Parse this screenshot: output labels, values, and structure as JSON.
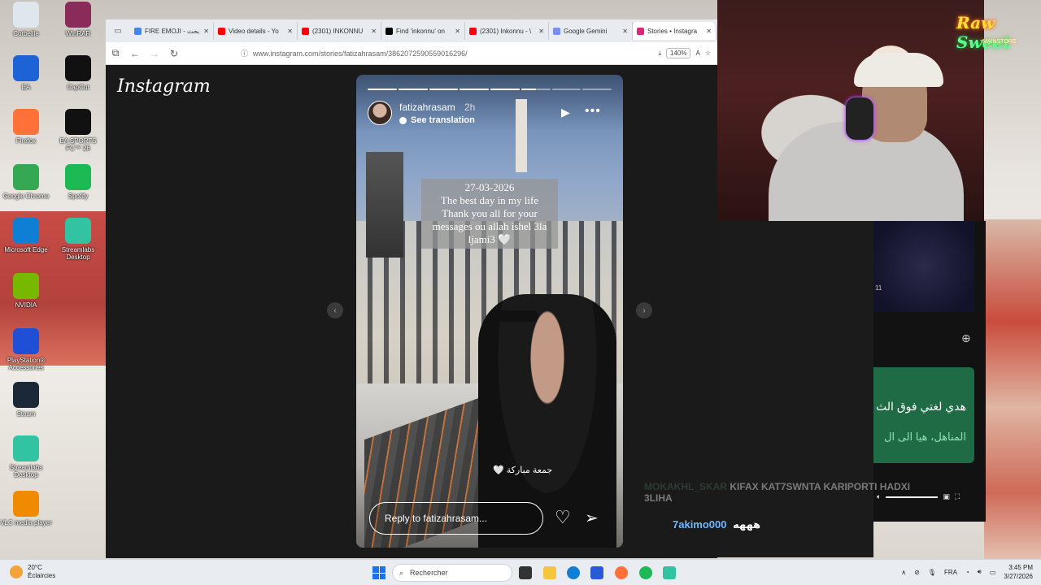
{
  "desktop": {
    "icons": [
      {
        "label": "Corbeille",
        "icon": "recycle-bin-icon",
        "color": "#dfe6ee"
      },
      {
        "label": "WinRAR",
        "icon": "winrar-icon",
        "color": "#8a2b5a"
      },
      {
        "label": "EA",
        "icon": "ea-icon",
        "color": "#1e63d6"
      },
      {
        "label": "CapCut",
        "icon": "capcut-icon",
        "color": "#111111"
      },
      {
        "label": "Firefox",
        "icon": "firefox-icon",
        "color": "#ff7139"
      },
      {
        "label": "EA SPORTS FC™ 26",
        "icon": "ea-fc-icon",
        "color": "#111111"
      },
      {
        "label": "Google Chrome",
        "icon": "chrome-icon",
        "color": "#34a853"
      },
      {
        "label": "Spotify",
        "icon": "spotify-icon",
        "color": "#1db954"
      },
      {
        "label": "Microsoft Edge",
        "icon": "edge-icon",
        "color": "#0f7fd6"
      },
      {
        "label": "Streamlabs Desktop",
        "icon": "streamlabs-icon",
        "color": "#31c3a2"
      },
      {
        "label": "NVIDIA",
        "icon": "nvidia-icon",
        "color": "#76b900"
      },
      {
        "label": "PlayStation® Accessories",
        "icon": "playstation-icon",
        "color": "#1e4fd6"
      },
      {
        "label": "Steam",
        "icon": "steam-icon",
        "color": "#1b2838"
      },
      {
        "label": "Streamlabs Desktop",
        "icon": "streamlabs-icon",
        "color": "#31c3a2"
      },
      {
        "label": "VLC media player",
        "icon": "vlc-icon",
        "color": "#f08a00"
      }
    ]
  },
  "browser": {
    "tabs": [
      {
        "label": "FIRE EMOJI - بحث",
        "fav_color": "#4285f4"
      },
      {
        "label": "Video details - Yo",
        "fav_color": "#ff0000"
      },
      {
        "label": "(2301) INKONNU",
        "fav_color": "#ff0000"
      },
      {
        "label": "Find 'inkonnu' on",
        "fav_color": "#000000"
      },
      {
        "label": "(2301) Inkonnu - \\",
        "fav_color": "#ff0000"
      },
      {
        "label": "Google Gemini",
        "fav_color": "#7b8cf5"
      },
      {
        "label": "Stories • Instagra",
        "fav_color": "#d62976"
      }
    ],
    "url": "www.instagram.com/stories/fatizahrasam/3862072590559016296/",
    "zoom": "140%"
  },
  "instagram": {
    "logo": "Instagram",
    "story": {
      "username": "fatizahrasam",
      "time": "2h",
      "see_translation": "See translation",
      "caption": "27-03-2026\nThe best day in my life\nThank you all for your messages ou allah ishel 3la ljami3 🤍",
      "sticker": "🤍 جمعة مباركة",
      "reply_placeholder": "Reply to fatizahrasam...",
      "progress_segments": 8,
      "progress_done": 5,
      "progress_current_fraction": 0.5
    }
  },
  "stream_overlay": {
    "neon_main": "Raw",
    "neon_accent": "Sweet",
    "neon_sub": "MAINSTORE",
    "media_badge": "11",
    "green_card_line1": "هدي لغتي فوق الث",
    "green_card_line2": "المناهل، هيا الى ال",
    "chat": [
      {
        "user": "MOKAKHL_SKAR",
        "message": "KIFAX KAT7SWNTA KARIPORTI HADXI 3LIHA"
      },
      {
        "user": "7akimo000",
        "message": "هههه"
      }
    ]
  },
  "taskbar": {
    "weather_temp": "20°C",
    "weather_desc": "Éclaircies",
    "search_placeholder": "Rechercher",
    "lang": "FRA",
    "time": "3:45 PM",
    "date": "3/27/2026"
  }
}
